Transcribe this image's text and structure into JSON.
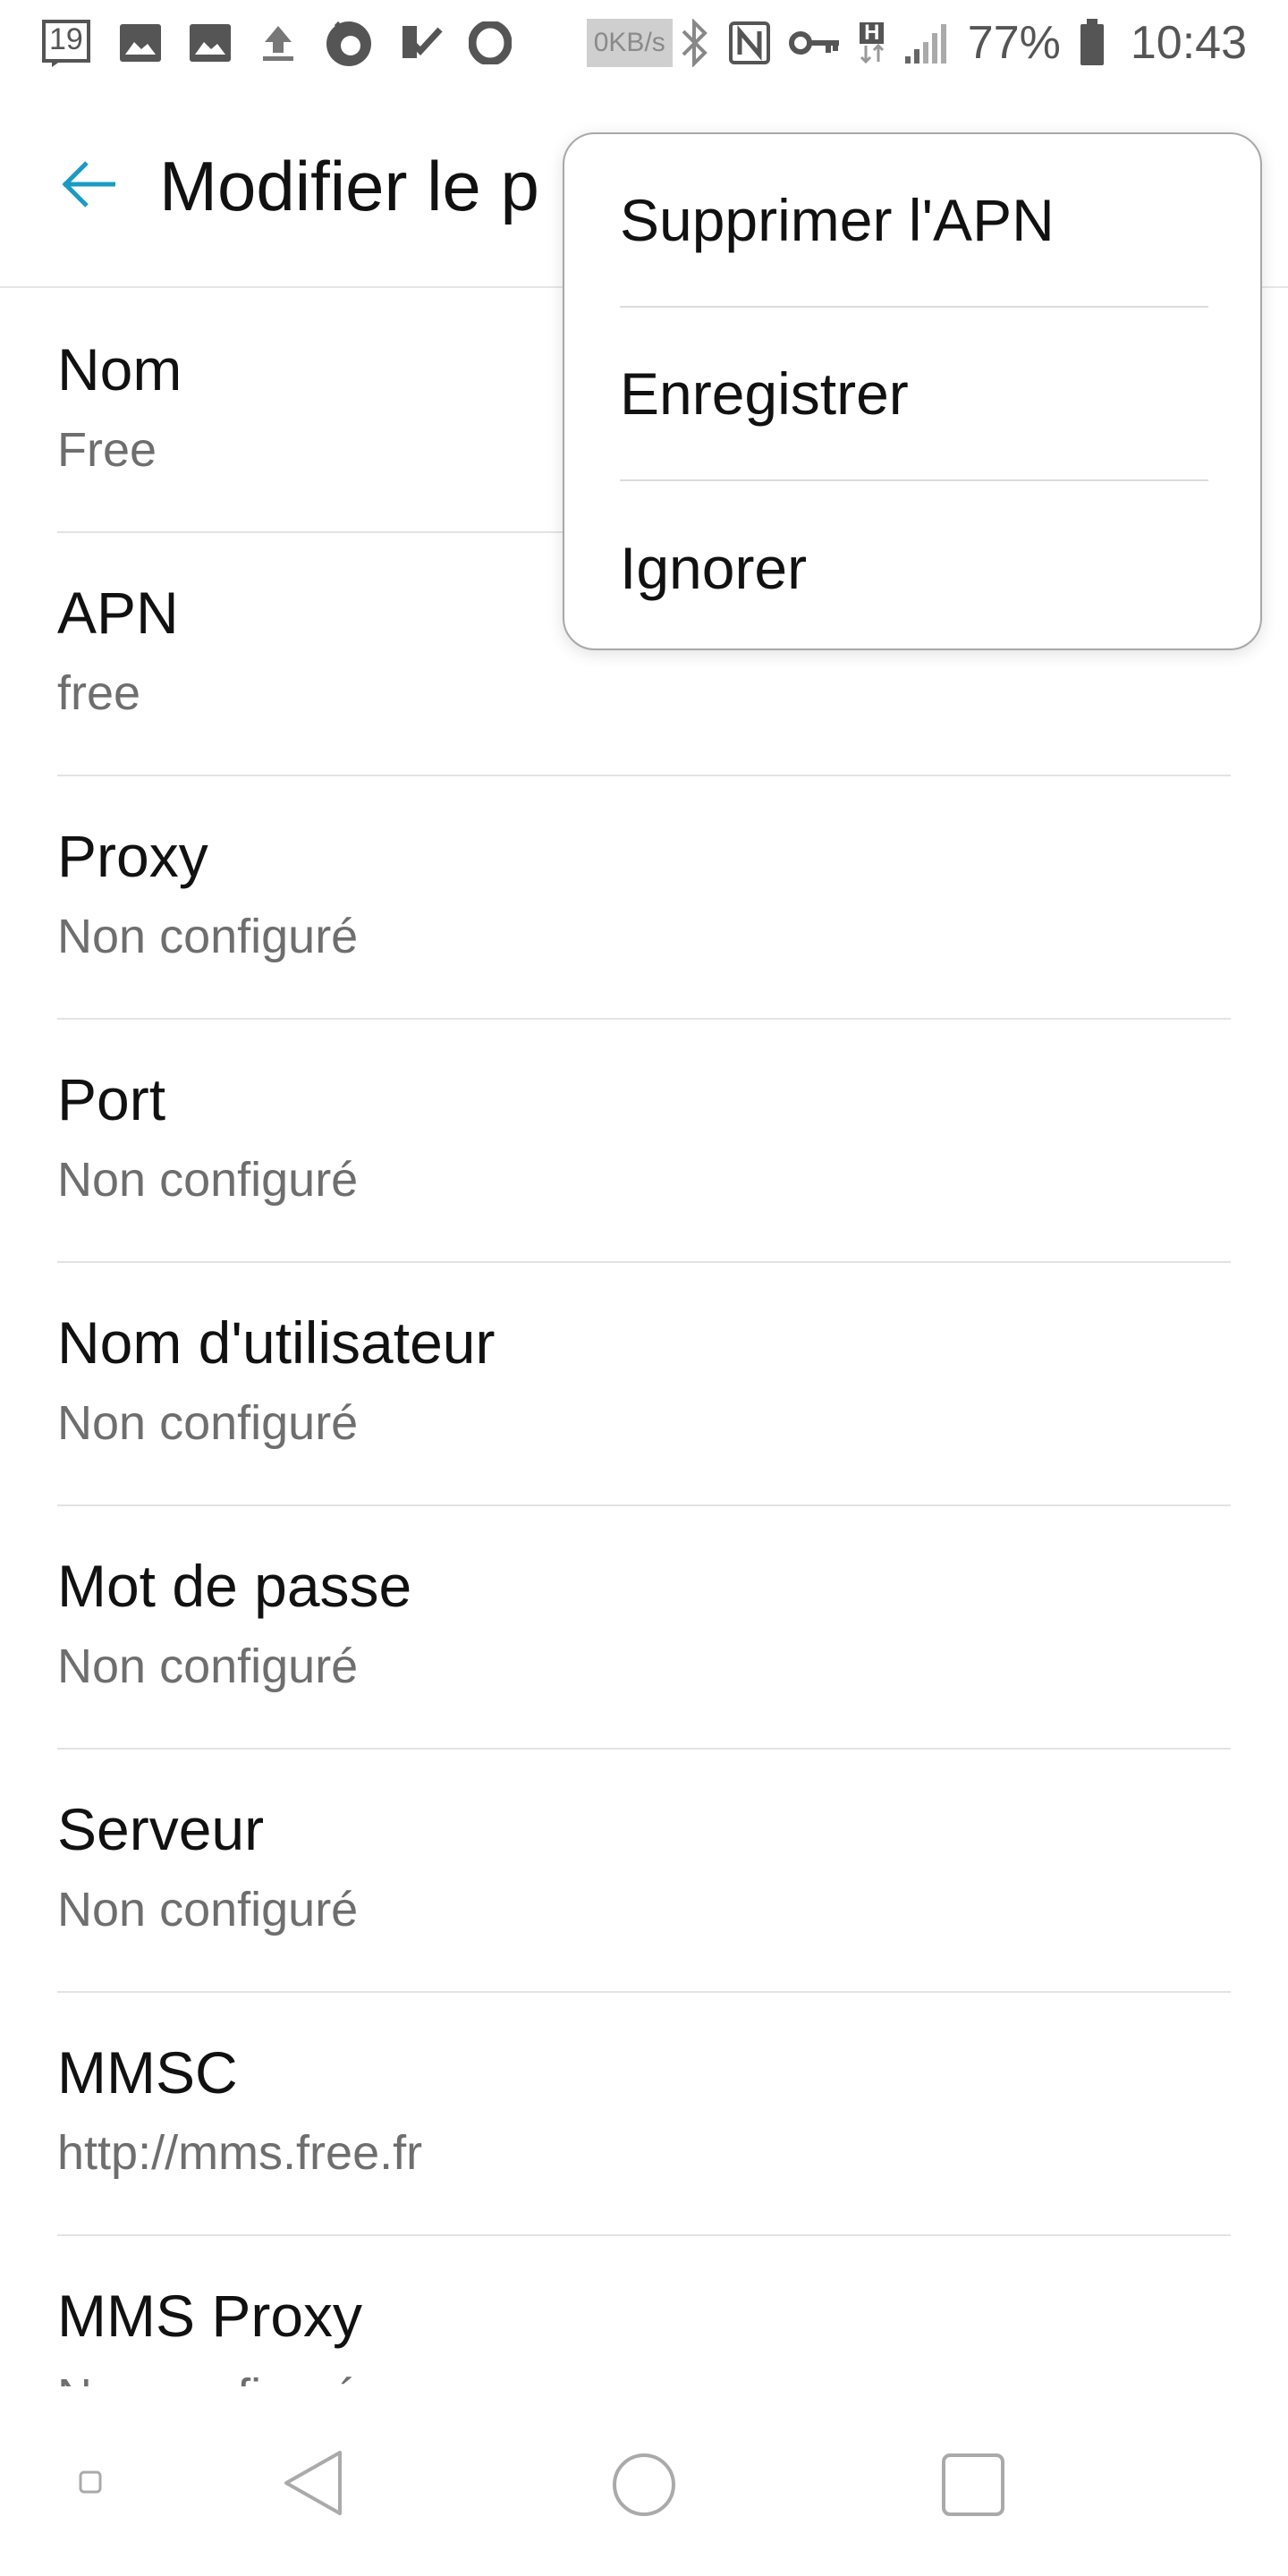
{
  "status_bar": {
    "notification_count": "19",
    "network_speed": "0KB/s",
    "network_type": "H",
    "battery_percent": "77%",
    "time": "10:43",
    "icons": [
      "calendar-icon",
      "image-icon",
      "image-icon",
      "upload-icon",
      "firefox-icon",
      "check-app-icon",
      "opera-icon",
      "bluetooth-icon",
      "nfc-icon",
      "vpn-key-icon",
      "mobile-data-icon",
      "signal-icon",
      "battery-icon"
    ]
  },
  "app_bar": {
    "title": "Modifier le p"
  },
  "menu": {
    "items": [
      {
        "label": "Supprimer l'APN"
      },
      {
        "label": "Enregistrer"
      },
      {
        "label": "Ignorer"
      }
    ]
  },
  "settings": {
    "items": [
      {
        "title": "Nom",
        "value": "Free"
      },
      {
        "title": "APN",
        "value": "free"
      },
      {
        "title": "Proxy",
        "value": "Non configuré"
      },
      {
        "title": "Port",
        "value": "Non configuré"
      },
      {
        "title": "Nom d'utilisateur",
        "value": "Non configuré"
      },
      {
        "title": "Mot de passe",
        "value": "Non configuré"
      },
      {
        "title": "Serveur",
        "value": "Non configuré"
      },
      {
        "title": "MMSC",
        "value": "http://mms.free.fr"
      },
      {
        "title": "MMS Proxy",
        "value": "Non configuré"
      }
    ]
  },
  "colors": {
    "accent": "#1a9bc4",
    "text_primary": "#111111",
    "text_secondary": "#6e6e6e",
    "divider": "#e3e3e3"
  }
}
